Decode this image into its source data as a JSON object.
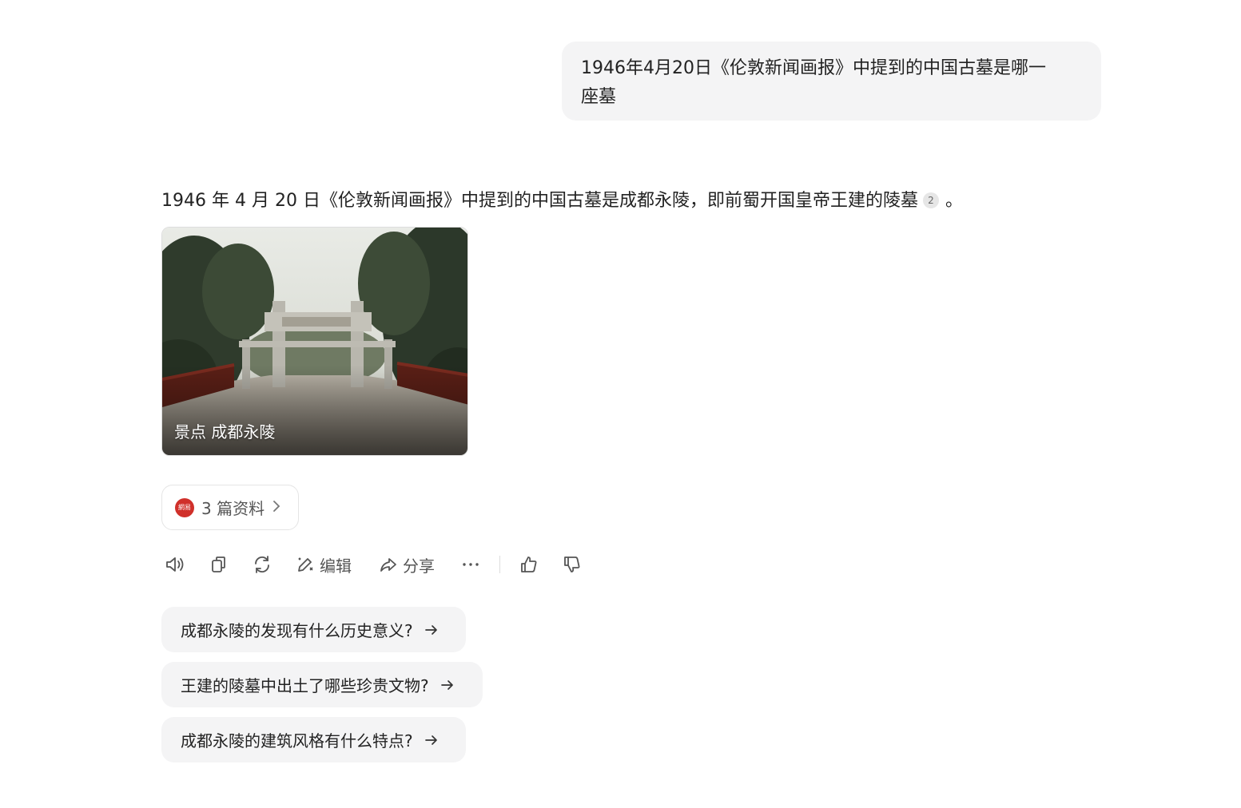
{
  "user_message": {
    "line1": "1946年4月20日《伦敦新闻画报》中提到的中国古墓是哪一",
    "line2": "座墓"
  },
  "answer": {
    "text": "1946 年 4 月 20 日《伦敦新闻画报》中提到的中国古墓是成都永陵，即前蜀开国皇帝王建的陵墓",
    "citation": "2",
    "end_punct": "。"
  },
  "image_card": {
    "caption": "景点 成都永陵"
  },
  "sources": {
    "logo_text": "網易",
    "label": "3 篇资料",
    "logo_color": "#d0302a"
  },
  "toolbar": {
    "edit_label": "编辑",
    "share_label": "分享"
  },
  "suggestions": [
    {
      "text": "成都永陵的发现有什么历史意义?"
    },
    {
      "text": "王建的陵墓中出土了哪些珍贵文物?"
    },
    {
      "text": "成都永陵的建筑风格有什么特点?"
    }
  ]
}
